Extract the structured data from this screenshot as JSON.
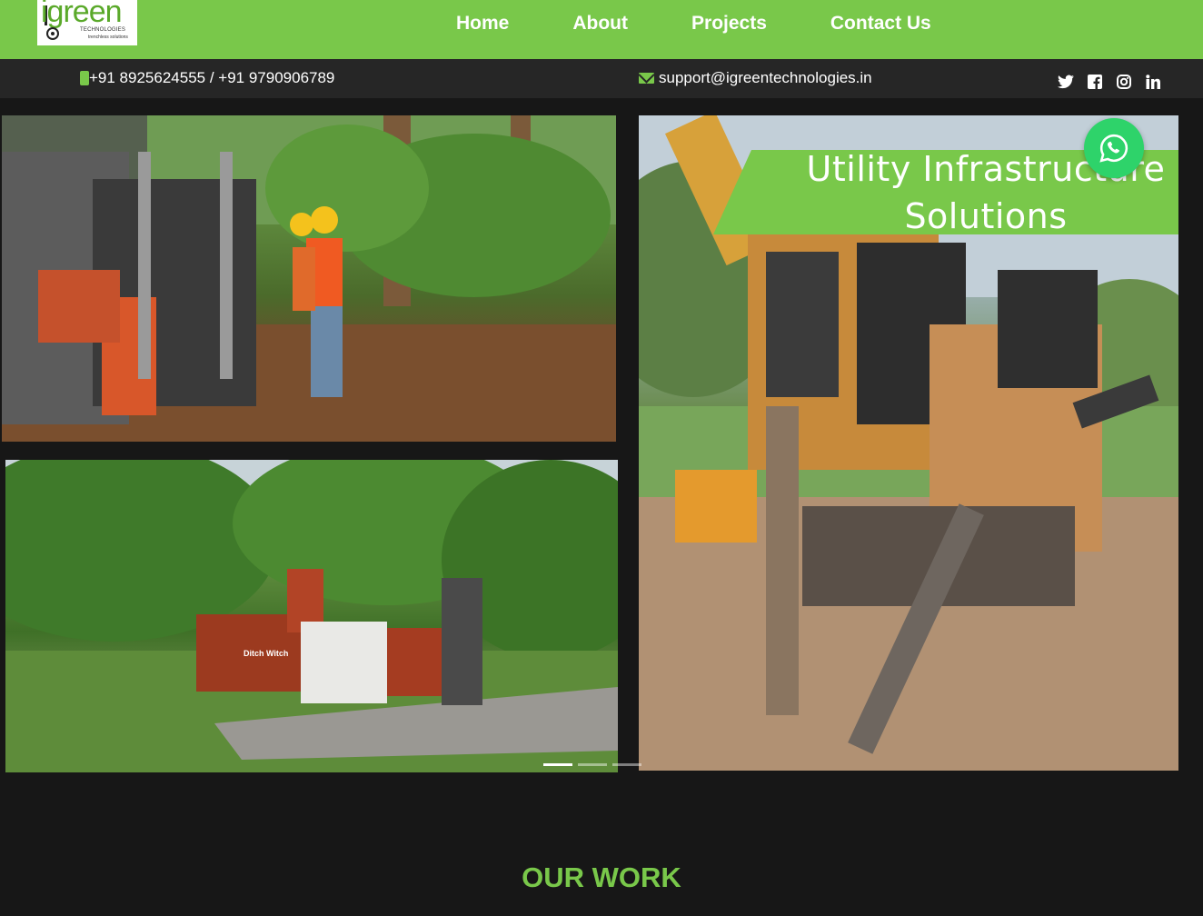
{
  "brand": {
    "logo_text": "igreen",
    "logo_sub": "TECHNOLOGIES",
    "logo_tagline": "trenchless solutions"
  },
  "nav": {
    "items": [
      {
        "label": "Home"
      },
      {
        "label": "About"
      },
      {
        "label": "Projects"
      },
      {
        "label": "Contact Us"
      }
    ]
  },
  "contact": {
    "phone": "+91 8925624555 / +91 9790906789",
    "email": "support@igreentechnologies.in",
    "socials": [
      "twitter-icon",
      "facebook-icon",
      "instagram-icon",
      "linkedin-icon"
    ]
  },
  "hero": {
    "banner_text": "Utility Infrastructure Solutions",
    "machine_label": "Ditch Witch",
    "carousel": {
      "count": 3,
      "active": 0
    }
  },
  "section": {
    "title": "OUR WORK"
  },
  "colors": {
    "brand_green": "#79c84a",
    "dark_bg": "#171717",
    "contact_bar": "#262626",
    "whatsapp": "#2ed36a"
  }
}
